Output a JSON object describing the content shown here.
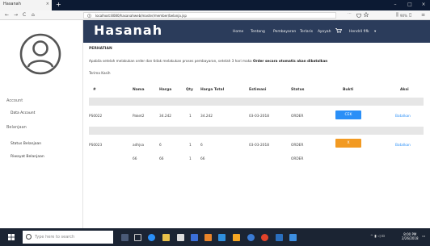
{
  "browser": {
    "tab_title": "Hasanah",
    "tab_close": "×",
    "new_tab": "+",
    "url": "localhost:8080/hasanahweb/master/member/belanja.jsp",
    "zoom": "90%",
    "url_more": "···",
    "window": {
      "minimize": "–",
      "maximize": "□",
      "close": "×"
    },
    "nav": {
      "back": "←",
      "forward": "→",
      "reload": "C",
      "home": "⌂"
    },
    "right_icons": {
      "library": "⫼",
      "sidebar": "▯",
      "menu": "≡"
    }
  },
  "sidebar": {
    "section_account": "Account",
    "item_data_account": "Data Account",
    "section_belanjaan": "Belanjaan",
    "item_status_belanjaan": "Status Belanjaan",
    "item_riwayat_belanjaan": "Riwayat Belanjaan"
  },
  "header": {
    "logo": "Hasanah",
    "nav": [
      "Home",
      "Tentang",
      "Pembayaran",
      "Terlaris",
      "Ayoyah"
    ],
    "user": "Hendril fifk"
  },
  "notice": {
    "title": "PERHATIAN",
    "body_plain": "Apabila setelah melakukan order dan tidak melakukan proses pembayaran, setelah 3 hari maka ",
    "body_bold": "Order secara otomatis akan dibatalkan",
    "thanks": "Terima Kasih"
  },
  "table": {
    "headers": [
      "#",
      "Nama",
      "Harga",
      "Qty",
      "Harga Total",
      "Estimasi",
      "Status",
      "Bukti",
      "Aksi"
    ],
    "rows": [
      {
        "id": "PS0022",
        "nama": "Paket2",
        "harga": "34.242",
        "qty": "1",
        "total": "34.242",
        "estimasi": "03-03-2018",
        "status": "ORDER",
        "bukti": "CEK",
        "aksi": "Batalkan"
      },
      {
        "id": "PS0023",
        "nama": "adhjsa",
        "harga": "6",
        "qty": "1",
        "total": "6",
        "estimasi": "03-03-2018",
        "status": "ORDER",
        "bukti": "X",
        "aksi": "Batalkan"
      }
    ],
    "subrow": {
      "nama": "66",
      "harga": "66",
      "qty": "1",
      "total": "66",
      "status": "ORDER"
    }
  },
  "taskbar": {
    "search_placeholder": "Type here to search",
    "time": "8:00 PM",
    "date": "2/26/2018"
  },
  "colors": {
    "header_bg": "#2b3c5b",
    "accent_blue": "#2a8ff7",
    "accent_orange": "#f29a22",
    "taskbar_bg": "#1b2433"
  }
}
